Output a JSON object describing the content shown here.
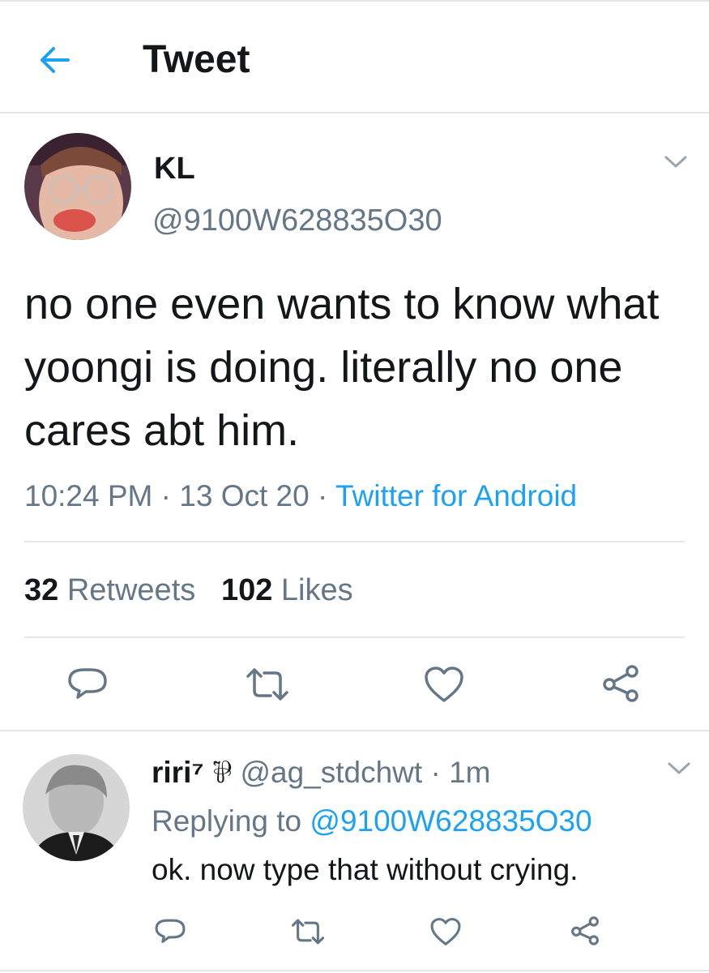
{
  "header": {
    "title": "Tweet",
    "back_icon": "arrow-left-icon",
    "accent": "#1da1f2"
  },
  "tweet": {
    "author_name": "KL",
    "author_handle": "@9100W628835O30",
    "text": "no one even wants to know what yoongi is doing. literally no one cares abt him.",
    "time": "10:24 PM",
    "date": "13 Oct 20",
    "source": "Twitter for Android",
    "dot": "·",
    "retweets_count": "32",
    "retweets_label": "Retweets",
    "likes_count": "102",
    "likes_label": "Likes"
  },
  "reply": {
    "author_name": "riri⁷",
    "author_badge": "⅌",
    "author_handle": "@ag_stdchwt",
    "time": "1m",
    "dot": "·",
    "replying_label": "Replying to",
    "replying_to": "@9100W628835O30",
    "text": "ok. now type that without crying."
  },
  "colors": {
    "text": "#14171a",
    "muted": "#657786",
    "link": "#1da1f2",
    "divider": "#e1e8ed"
  },
  "icons": [
    "reply-icon",
    "retweet-icon",
    "like-icon",
    "share-icon",
    "chevron-down-icon"
  ]
}
